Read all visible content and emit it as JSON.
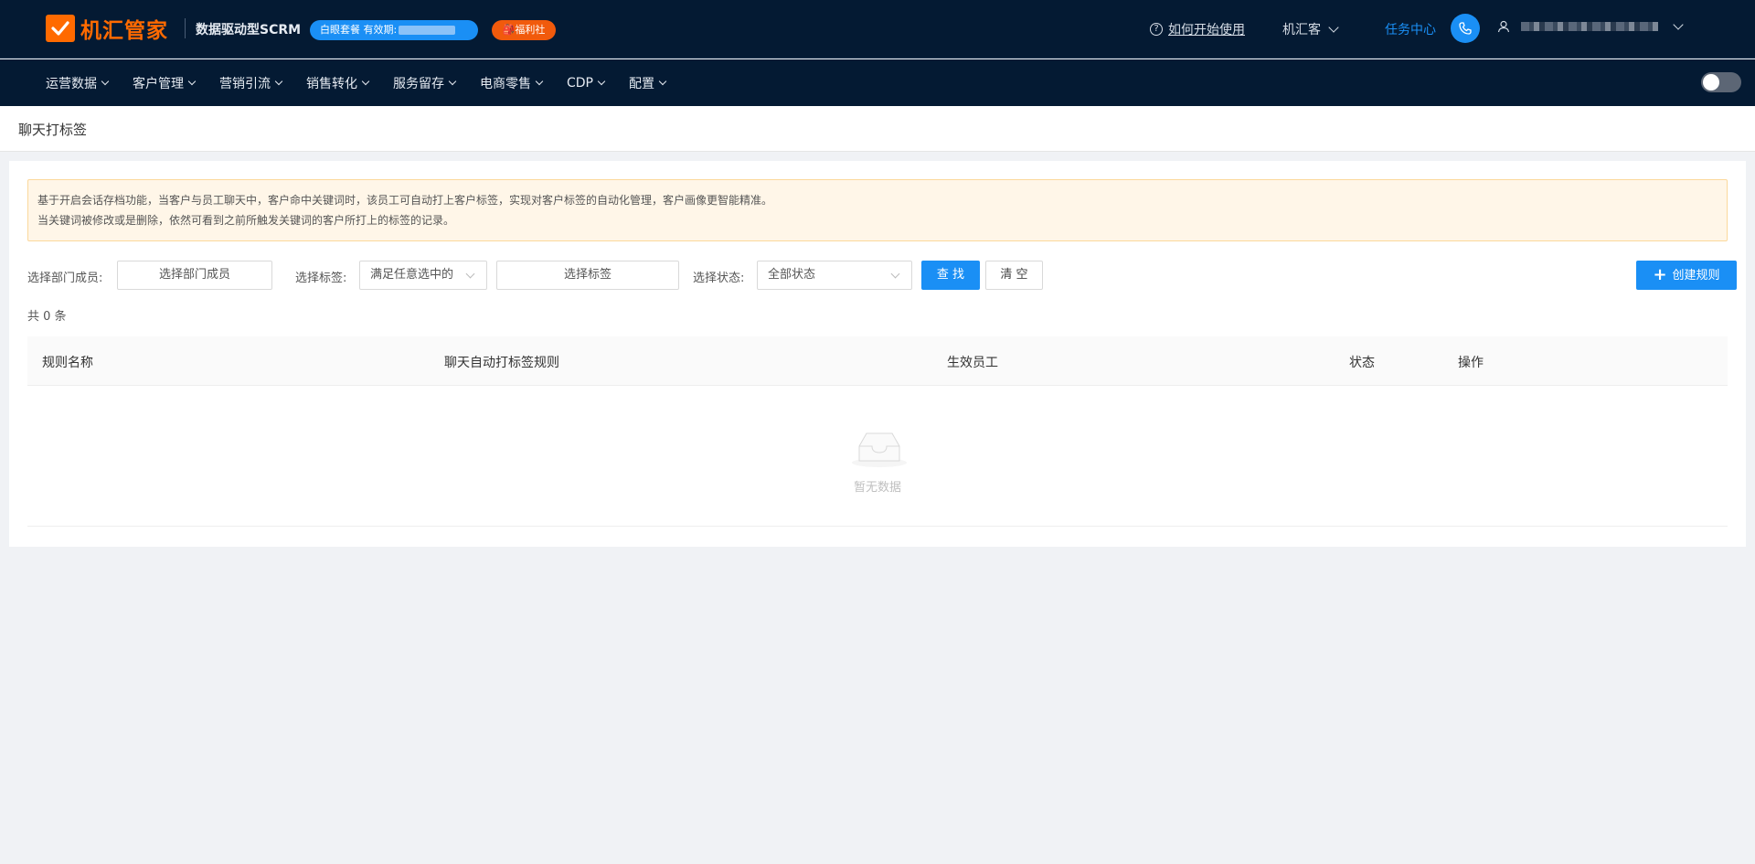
{
  "header": {
    "logo_text": "机汇管家",
    "slogan": "数据驱动型SCRM",
    "package_badge": "白眼套餐 有效期:",
    "welfare_badge": "🎒福利社",
    "help_link": "如何开始使用",
    "corp_name": "机汇客",
    "task_center": "任务中心"
  },
  "nav": {
    "items": [
      "运营数据",
      "客户管理",
      "营销引流",
      "销售转化",
      "服务留存",
      "电商零售",
      "CDP",
      "配置"
    ]
  },
  "page": {
    "title": "聊天打标签"
  },
  "notice": {
    "line1": "基于开启会话存档功能，当客户与员工聊天中，客户命中关键词时，该员工可自动打上客户标签，实现对客户标签的自动化管理，客户画像更智能精准。",
    "line2": "当关键词被修改或是删除，依然可看到之前所触发关键词的客户所打上的标签的记录。"
  },
  "filters": {
    "member_label": "选择部门成员:",
    "member_placeholder": "选择部门成员",
    "tag_label": "选择标签:",
    "tag_mode": "满足任意选中的",
    "tag_placeholder": "选择标签",
    "status_label": "选择状态:",
    "status_value": "全部状态",
    "search_button": "查 找",
    "clear_button": "清 空",
    "create_button": "创建规则"
  },
  "summary": {
    "count_text": "共 0 条"
  },
  "table": {
    "columns": [
      "规则名称",
      "聊天自动打标签规则",
      "生效员工",
      "状态",
      "操作"
    ],
    "rows": [],
    "empty_text": "暂无数据"
  },
  "colors": {
    "header_bg": "#041a33",
    "brand_orange": "#ff6a00",
    "primary_blue": "#1a8ff5",
    "notice_bg": "#fff6e8"
  }
}
